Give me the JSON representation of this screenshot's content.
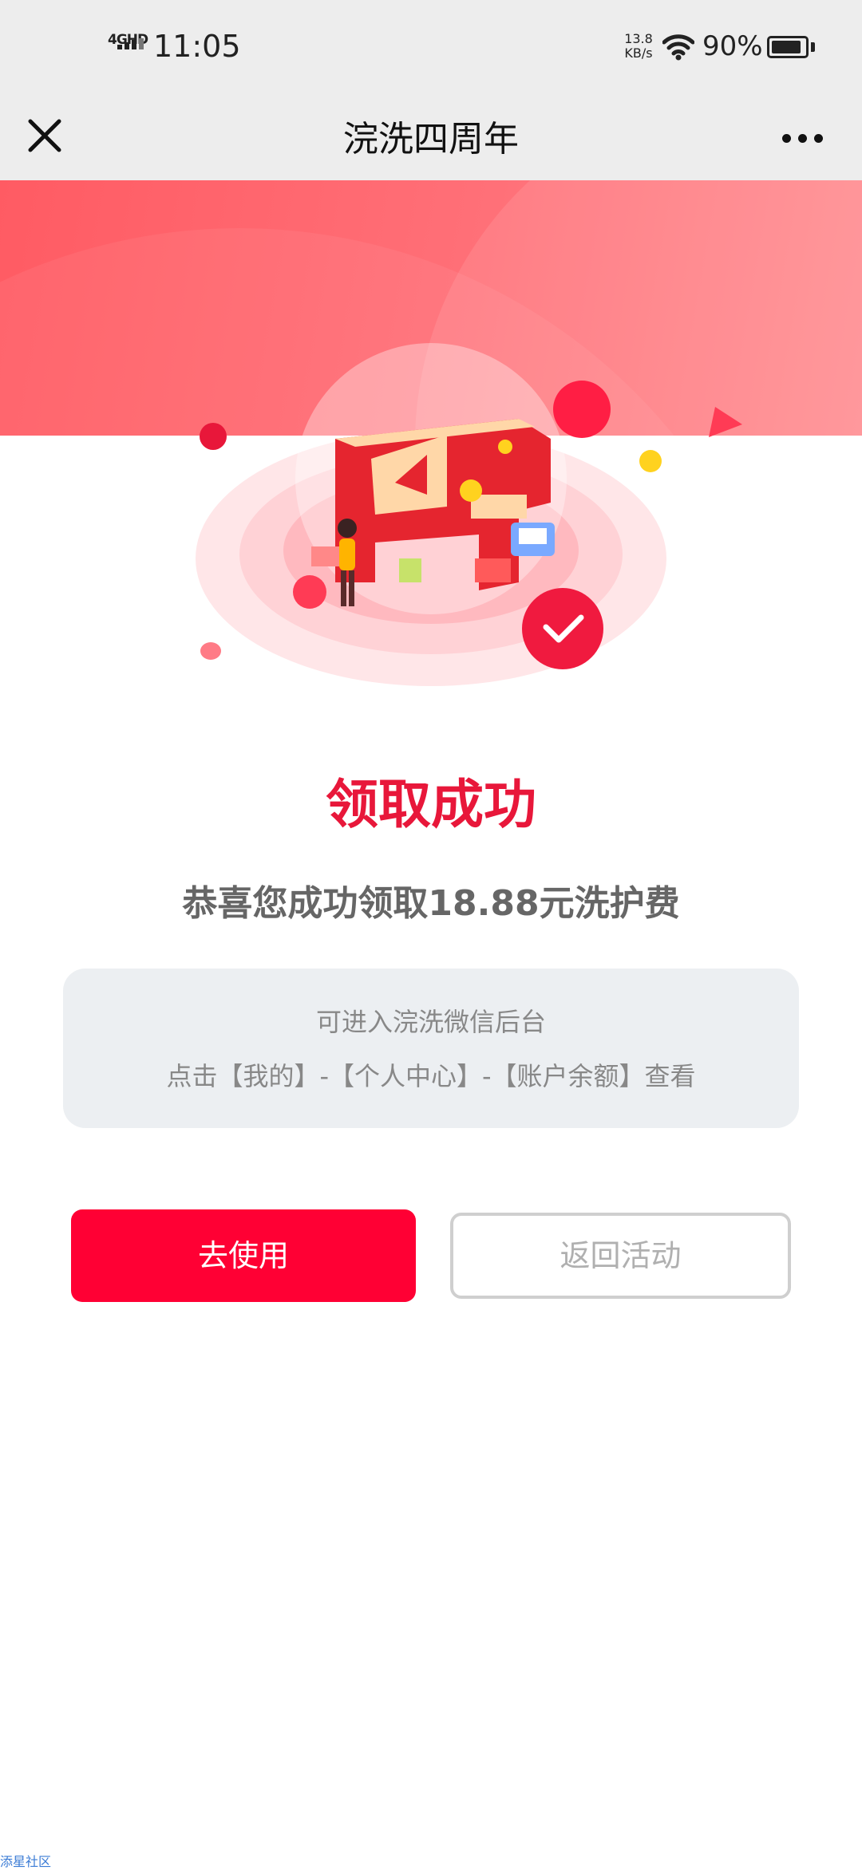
{
  "status_bar": {
    "network": "4GHD",
    "time": "11:05",
    "speed_value": "13.8",
    "speed_unit": "KB/s",
    "battery": "90%",
    "battery_level": 0.9
  },
  "nav": {
    "title": "浣洗四周年",
    "close_icon": "close-icon",
    "more_icon": "more-dots-icon"
  },
  "hero": {
    "badge_number": "4",
    "check_icon": "check-icon"
  },
  "result": {
    "title": "领取成功",
    "description": "恭喜您成功领取18.88元洗护费"
  },
  "info": {
    "line1": "可进入浣洗微信后台",
    "line2": "点击【我的】-【个人中心】-【账户余额】查看"
  },
  "actions": {
    "use_label": "去使用",
    "back_label": "返回活动"
  },
  "watermark": "添星社区",
  "colors": {
    "accent": "#ff0034",
    "title_red": "#e8173a",
    "banner": "#ff6b73"
  }
}
